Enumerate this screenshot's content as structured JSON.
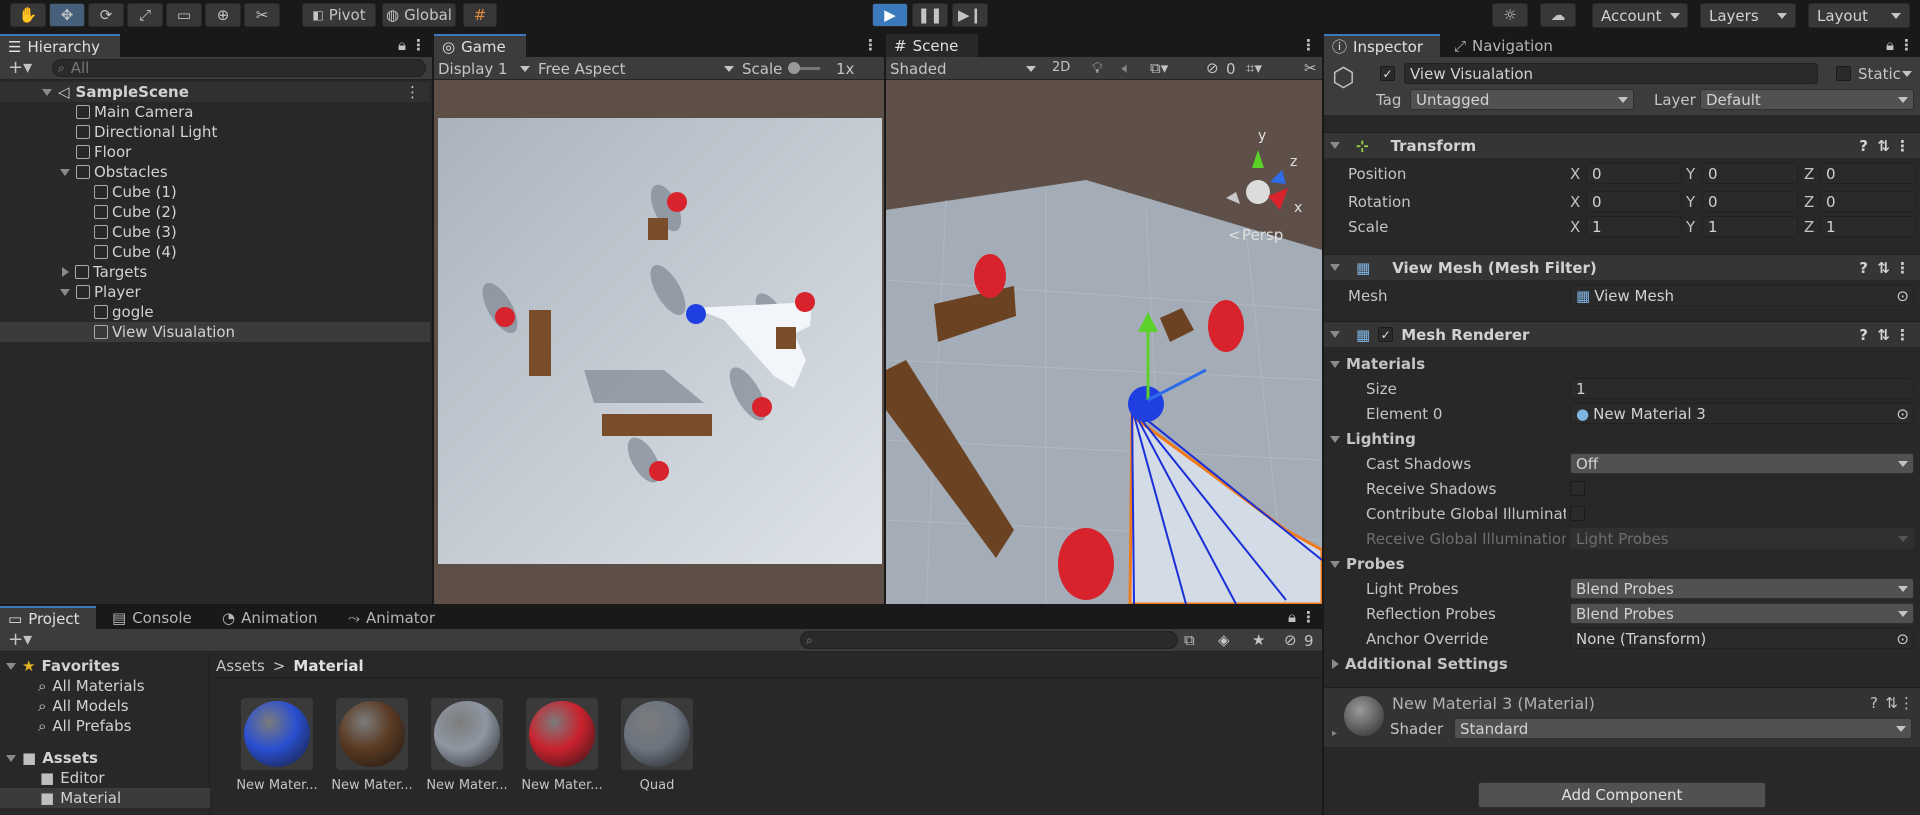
{
  "toolbar": {
    "pivot_label": "Pivot",
    "global_label": "Global",
    "account_label": "Account",
    "layers_label": "Layers",
    "layout_label": "Layout"
  },
  "hierarchy": {
    "tab_label": "Hierarchy",
    "search_placeholder": "All",
    "scene_name": "SampleScene",
    "items": [
      {
        "label": "Main Camera"
      },
      {
        "label": "Directional Light"
      },
      {
        "label": "Floor"
      },
      {
        "label": "Obstacles"
      },
      {
        "label": "Cube (1)"
      },
      {
        "label": "Cube (2)"
      },
      {
        "label": "Cube (3)"
      },
      {
        "label": "Cube (4)"
      },
      {
        "label": "Targets"
      },
      {
        "label": "Player"
      },
      {
        "label": "gogle"
      },
      {
        "label": "View Visualation"
      }
    ]
  },
  "game": {
    "tab_label": "Game",
    "display": "Display 1",
    "aspect": "Free Aspect",
    "scale_label": "Scale",
    "scale_value": "1x"
  },
  "scene": {
    "tab_label": "Scene",
    "shading": "Shaded",
    "mode_2d": "2D",
    "hidden_count": "0",
    "persp_label": "Persp",
    "axis_y": "y",
    "axis_z": "z",
    "axis_x": "x"
  },
  "project": {
    "tabs": [
      "Project",
      "Console",
      "Animation",
      "Animator"
    ],
    "hidden_count": "9",
    "breadcrumb_root": "Assets",
    "breadcrumb_sep": ">",
    "breadcrumb_current": "Material",
    "favorites_label": "Favorites",
    "favorites": [
      "All Materials",
      "All Models",
      "All Prefabs"
    ],
    "assets_label": "Assets",
    "folders": [
      "Editor",
      "Material"
    ],
    "assets": [
      {
        "label": "New Mater...",
        "color": "#2a4fd1"
      },
      {
        "label": "New Mater...",
        "color": "#5a3a22"
      },
      {
        "label": "New Mater...",
        "color": "#8f97a3"
      },
      {
        "label": "New Mater...",
        "color": "#c9222e"
      },
      {
        "label": "Quad",
        "color": "#6c7480"
      }
    ]
  },
  "inspector": {
    "tab_label": "Inspector",
    "nav_tab_label": "Navigation",
    "object_name": "View Visualation",
    "static_label": "Static",
    "tag_label": "Tag",
    "tag_value": "Untagged",
    "layer_label": "Layer",
    "layer_value": "Default",
    "transform": {
      "title": "Transform",
      "position_label": "Position",
      "rotation_label": "Rotation",
      "scale_label": "Scale",
      "x_label": "X",
      "y_label": "Y",
      "z_label": "Z",
      "position": [
        "0",
        "0",
        "0"
      ],
      "rotation": [
        "0",
        "0",
        "0"
      ],
      "scale": [
        "1",
        "1",
        "1"
      ]
    },
    "mesh_filter": {
      "title": "View Mesh (Mesh Filter)",
      "mesh_label": "Mesh",
      "mesh_value": "View Mesh"
    },
    "mesh_renderer": {
      "title": "Mesh Renderer",
      "materials_label": "Materials",
      "size_label": "Size",
      "size_value": "1",
      "element0_label": "Element 0",
      "element0_value": "New Material 3",
      "lighting_label": "Lighting",
      "cast_shadows_label": "Cast Shadows",
      "cast_shadows_value": "Off",
      "receive_shadows_label": "Receive Shadows",
      "contribute_gi_label": "Contribute Global Illuminatic",
      "receive_gi_label": "Receive Global Illumination",
      "receive_gi_value": "Light Probes",
      "probes_label": "Probes",
      "light_probes_label": "Light Probes",
      "light_probes_value": "Blend Probes",
      "reflection_probes_label": "Reflection Probes",
      "reflection_probes_value": "Blend Probes",
      "anchor_override_label": "Anchor Override",
      "anchor_override_value": "None (Transform)",
      "additional_settings_label": "Additional Settings"
    },
    "material": {
      "title": "New Material 3 (Material)",
      "shader_label": "Shader",
      "shader_value": "Standard"
    },
    "add_component_label": "Add Component"
  }
}
